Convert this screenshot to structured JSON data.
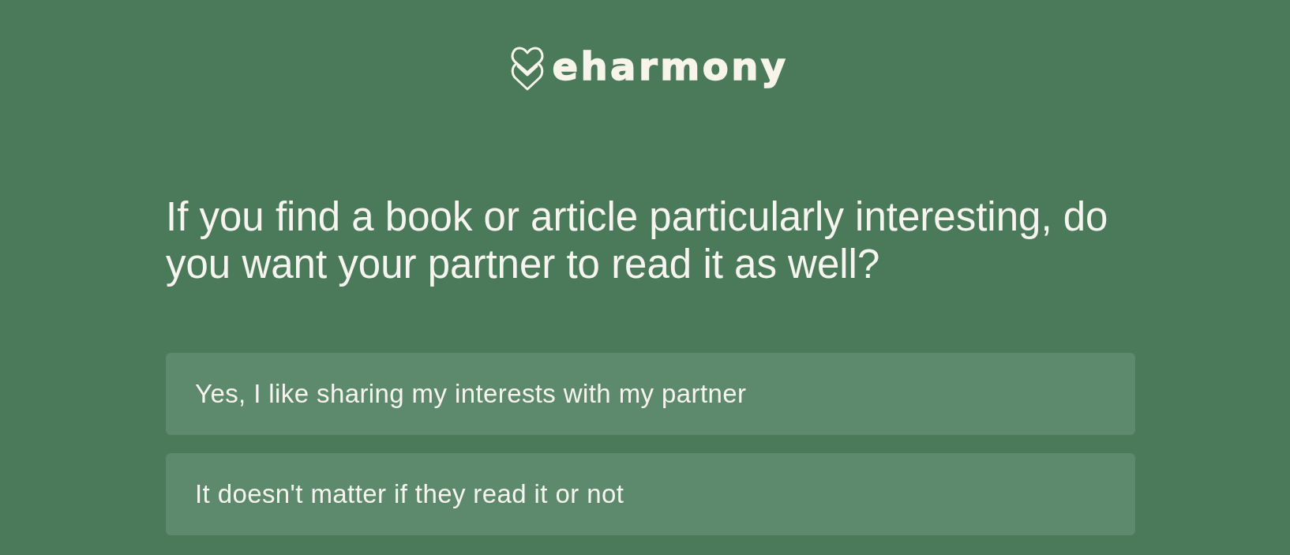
{
  "logo": {
    "text": "eharmony"
  },
  "question": "If you find a book or article particularly interesting, do you want your partner to read it as well?",
  "options": [
    {
      "label": "Yes, I like sharing my interests with my partner",
      "selected": false
    },
    {
      "label": "It doesn't matter if they read it or not",
      "selected": false
    }
  ]
}
